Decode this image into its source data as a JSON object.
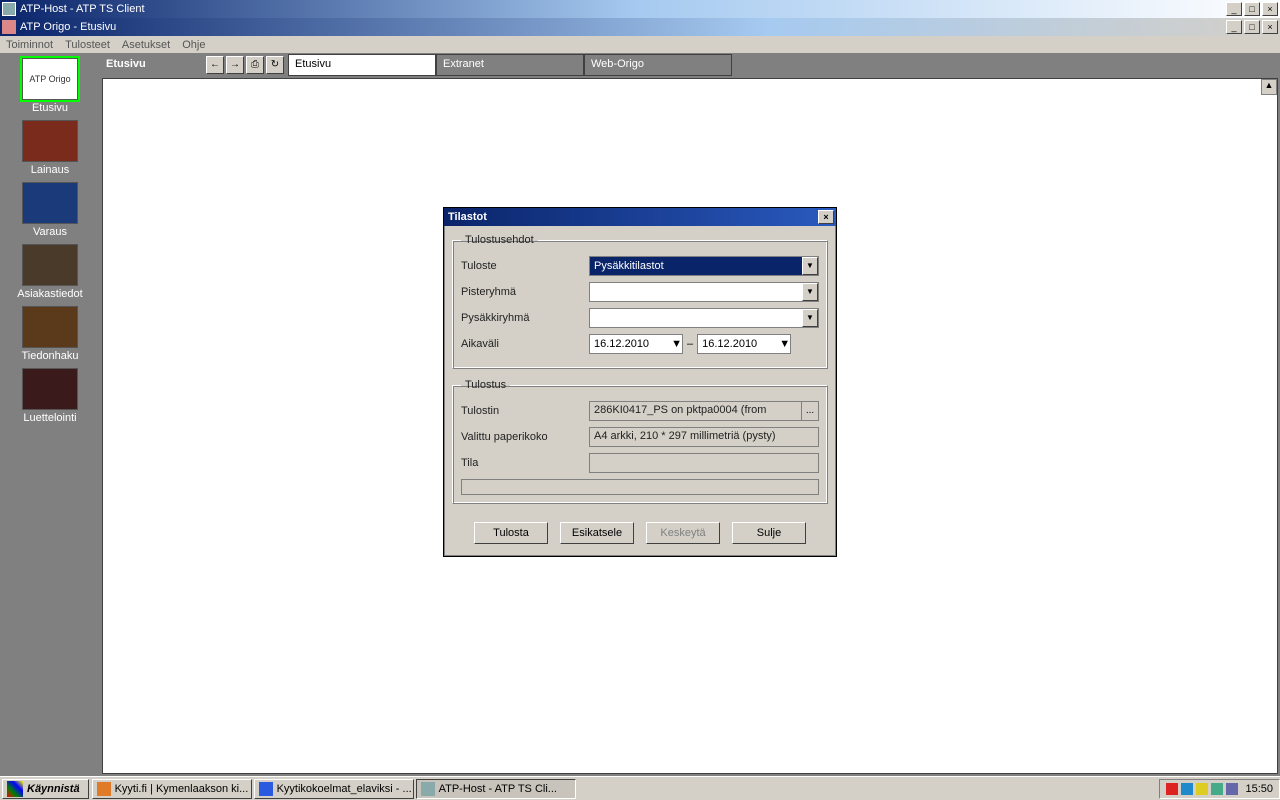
{
  "outer_window": {
    "title": "ATP-Host - ATP TS Client"
  },
  "inner_window": {
    "title": "ATP Origo - Etusivu"
  },
  "menu": {
    "items": [
      "Toiminnot",
      "Tulosteet",
      "Asetukset",
      "Ohje"
    ]
  },
  "sidebar": {
    "items": [
      {
        "label": "Etusivu",
        "icon_text": "ATP Origo",
        "selected": true
      },
      {
        "label": "Lainaus"
      },
      {
        "label": "Varaus"
      },
      {
        "label": "Asiakastiedot"
      },
      {
        "label": "Tiedonhaku"
      },
      {
        "label": "Luettelointi"
      }
    ]
  },
  "toolstrip": {
    "label": "Etusivu",
    "tabs": [
      "Etusivu",
      "Extranet",
      "Web-Origo"
    ]
  },
  "dialog": {
    "title": "Tilastot",
    "group1": {
      "legend": "Tulostusehdot",
      "fields": {
        "tuloste_label": "Tuloste",
        "tuloste_value": "Pysäkkitilastot",
        "pisteryhma_label": "Pisteryhmä",
        "pisteryhma_value": "",
        "pysakkiryhma_label": "Pysäkkiryhmä",
        "pysakkiryhma_value": "",
        "aikavali_label": "Aikaväli",
        "date_from": "16.12.2010",
        "date_sep": "–",
        "date_to": "16.12.2010"
      }
    },
    "group2": {
      "legend": "Tulostus",
      "fields": {
        "tulostin_label": "Tulostin",
        "tulostin_value": "286KI0417_PS on pktpa0004 (from",
        "paperikoko_label": "Valittu paperikoko",
        "paperikoko_value": "A4 arkki, 210 * 297 millimetriä (pysty)",
        "tila_label": "Tila",
        "tila_value": ""
      }
    },
    "buttons": {
      "tulosta": "Tulosta",
      "esikatsele": "Esikatsele",
      "keskeyta": "Keskeytä",
      "sulje": "Sulje"
    }
  },
  "taskbar": {
    "start": "Käynnistä",
    "tasks": [
      "Kyyti.fi | Kymenlaakson ki...",
      "Kyytikokoelmat_elaviksi - ...",
      "ATP-Host - ATP TS Cli..."
    ],
    "clock": "15:50"
  },
  "registered_mark": "®"
}
